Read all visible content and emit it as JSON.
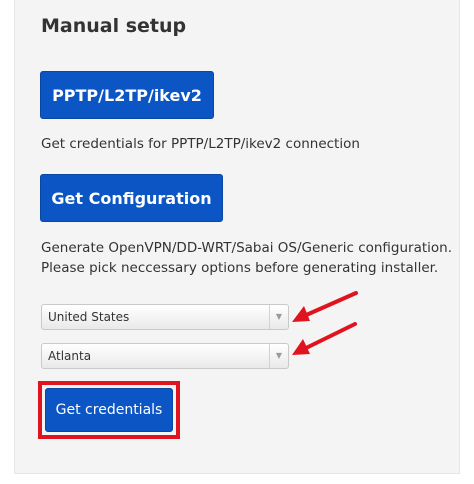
{
  "section": {
    "title": "Manual setup"
  },
  "pptp": {
    "button_label": "PPTP/L2TP/ikev2",
    "description": "Get credentials for PPTP/L2TP/ikev2 connection"
  },
  "config": {
    "button_label": "Get Configuration",
    "description_line1": "Generate OpenVPN/DD-WRT/Sabai OS/Generic configuration.",
    "description_line2": "Please pick neccessary options before generating installer."
  },
  "country_select": {
    "value": "United States"
  },
  "city_select": {
    "value": "Atlanta"
  },
  "credentials": {
    "button_label": "Get credentials"
  },
  "colors": {
    "button_blue": "#0b55c4",
    "highlight_red": "#e0141e",
    "arrow_red": "#e0141e",
    "panel_bg": "#f4f4f4"
  },
  "icons": {
    "select_arrow": "chevron-down-icon",
    "annotation_arrow": "red-arrow-icon"
  }
}
